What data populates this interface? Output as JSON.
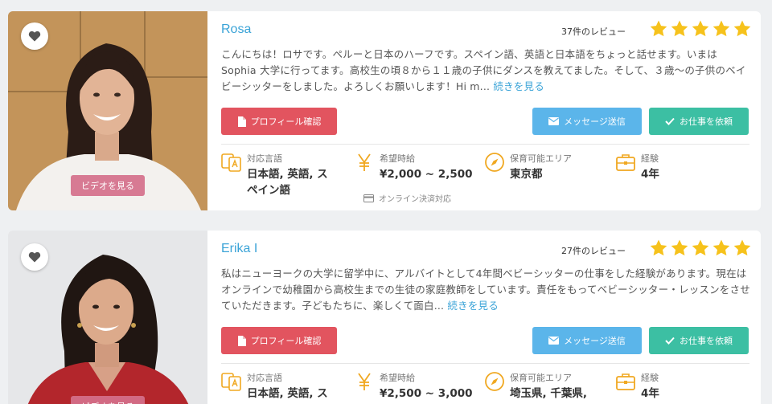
{
  "colors": {
    "accent": "#3aa3d7",
    "profile": "#e2545f",
    "message": "#5bb5ea",
    "hire": "#3cbfa3",
    "star": "#f6c21c",
    "icon": "#f0a821"
  },
  "labels": {
    "reviews_suffix": "件のレビュー",
    "profile_btn": "プロフィール確認",
    "message_btn": "メッセージ送信",
    "hire_btn": "お仕事を依頼",
    "video_btn": "ビデオを見る",
    "lang_label": "対応言語",
    "rate_label": "希望時給",
    "area_label": "保育可能エリア",
    "exp_label": "経験",
    "read_more": "続きを見る"
  },
  "sitters": [
    {
      "name": "Rosa",
      "reviews": "37件のレビュー",
      "rating": 5,
      "description": "こんにちは！ロサです。ペルーと日本のハーフです。スペイン語、英語と日本語をちょっと話せます。いまはSophia 大学に行ってます。高校生の頃８から１１歳の子供にダンスを教えてました。そして、３歳～の子供のベイビーシッターをしました。よろしくお願いします！Hi m...",
      "languages_line1": "日本語, 英語, ス",
      "languages_line2": "ペイン語",
      "rate": "¥2,000 ~ 2,500",
      "rate_note": "オンライン決済対応",
      "area": "東京都",
      "experience": "4年"
    },
    {
      "name": "Erika I",
      "reviews": "27件のレビュー",
      "rating": 5,
      "description": "私はニューヨークの大学に留学中に、アルバイトとして4年間ベビーシッターの仕事をした経験があります。現在はオンラインで幼稚園から高校生までの生徒の家庭教師をしています。責任をもってベビーシッター・レッスンをさせていただきます。子どもたちに、楽しくて面白...",
      "languages_line1": "日本語, 英語, ス",
      "rate": "¥2,500 ~ 3,000",
      "area": "埼玉県, 千葉県,",
      "experience": "4年"
    }
  ]
}
